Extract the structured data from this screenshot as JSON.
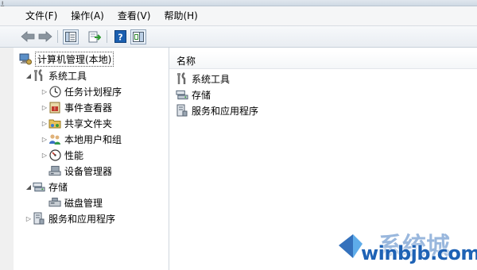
{
  "menubar": {
    "items": [
      {
        "label": "文件(F)"
      },
      {
        "label": "操作(A)"
      },
      {
        "label": "查看(V)"
      },
      {
        "label": "帮助(H)"
      }
    ]
  },
  "toolbar": {
    "buttons": [
      "back-icon",
      "forward-icon",
      "show-hide-console-tree-icon",
      "export-list-icon",
      "help-icon",
      "action-pane-icon"
    ]
  },
  "tree": {
    "root": {
      "label": "计算机管理(本地)"
    },
    "system_tools": {
      "label": "系统工具"
    },
    "task_scheduler": {
      "label": "任务计划程序"
    },
    "event_viewer": {
      "label": "事件查看器"
    },
    "shared_folders": {
      "label": "共享文件夹"
    },
    "local_users": {
      "label": "本地用户和组"
    },
    "performance": {
      "label": "性能"
    },
    "device_manager": {
      "label": "设备管理器"
    },
    "storage": {
      "label": "存储"
    },
    "disk_management": {
      "label": "磁盘管理"
    },
    "services_apps": {
      "label": "服务和应用程序"
    }
  },
  "list": {
    "column_name": "名称",
    "items": [
      {
        "label": "系统工具"
      },
      {
        "label": "存储"
      },
      {
        "label": "服务和应用程序"
      }
    ]
  },
  "watermark": {
    "brand": "系统城",
    "url": "winbjb.com"
  },
  "colors": {
    "accent_blue": "#1b75c8",
    "watermark_blue": "#1e62b5"
  }
}
